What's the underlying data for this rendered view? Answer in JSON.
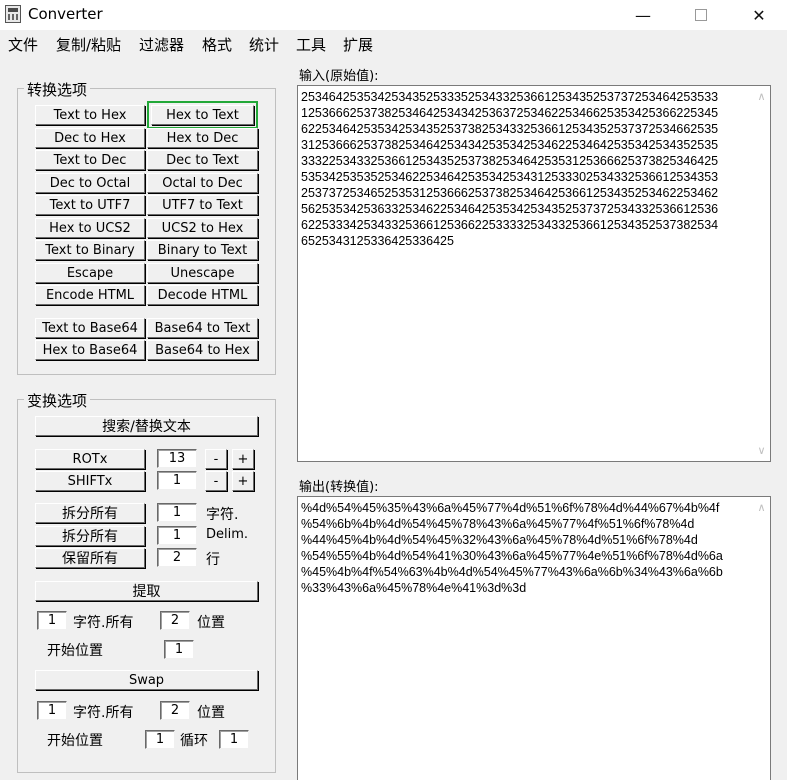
{
  "window": {
    "title": "Converter",
    "minimize": "—",
    "close": "✕"
  },
  "menu": [
    "文件",
    "复制/粘贴",
    "过滤器",
    "格式",
    "统计",
    "工具",
    "扩展"
  ],
  "convert_group": {
    "title": "转换选项",
    "buttons": [
      [
        "Text to Hex",
        "Hex to Text"
      ],
      [
        "Dec to Hex",
        "Hex to Dec"
      ],
      [
        "Text to Dec",
        "Dec to Text"
      ],
      [
        "Dec to Octal",
        "Octal to Dec"
      ],
      [
        "Text to UTF7",
        "UTF7 to Text"
      ],
      [
        "Hex to UCS2",
        "UCS2 to Hex"
      ],
      [
        "Text to Binary",
        "Binary to Text"
      ],
      [
        "Escape",
        "Unescape"
      ],
      [
        "Encode HTML",
        "Decode HTML"
      ],
      [
        "Text to Base64",
        "Base64 to Text"
      ],
      [
        "Hex to Base64",
        "Base64 to Hex"
      ]
    ]
  },
  "transform_group": {
    "title": "变换选项",
    "search_replace": "搜索/替换文本",
    "rot_label": "ROTx",
    "rot_value": "13",
    "shift_label": "SHIFTx",
    "shift_value": "1",
    "minus": "-",
    "plus": "+",
    "split_all_1": "拆分所有",
    "split_all_1_value": "1",
    "split_all_1_unit": "字符.",
    "split_all_2": "拆分所有",
    "split_all_2_value": "1",
    "split_all_2_unit": "Delim.",
    "keep_all": "保留所有",
    "keep_all_value": "2",
    "keep_all_unit": "行",
    "extract": "提取",
    "ex_value1": "1",
    "ex_char_all": "字符.所有",
    "ex_value2": "2",
    "ex_pos": "位置",
    "ex_start_label": "开始位置",
    "ex_start_value": "1",
    "swap": "Swap",
    "sw_value1": "1",
    "sw_char_all": "字符.所有",
    "sw_value2": "2",
    "sw_pos": "位置",
    "sw_start_label": "开始位置",
    "sw_start_value": "1",
    "sw_loop_label": "循环",
    "sw_loop_value": "1"
  },
  "input": {
    "label": "输入(原始值):",
    "lines": [
      "253464253534253435253335253433253661253435253737253464253533",
      "125366625373825346425343425363725346225346625353425366225345",
      "622534642535342534352537382534332536612534352537372534662535",
      "312536662537382534642534342535342534622534642535342534352535",
      "333225343325366125343525373825346425353125366625373825346425",
      "535342535352534622534642535342534312533302534332536612534353",
      "253737253465253531253666253738253464253661253435253462253462",
      "562535342536332534622534642535342534352537372534332536612536",
      "622533342534332536612536622533332534332536612534352537382534",
      "6525343125336425336425"
    ]
  },
  "output": {
    "label": "输出(转换值):",
    "lines": [
      "%4d%54%45%35%43%6a%45%77%4d%51%6f%78%4d%44%67%4b%4f",
      "%54%6b%4b%4d%54%45%78%43%6a%45%77%4f%51%6f%78%4d",
      "%44%45%4b%4d%54%45%32%43%6a%45%78%4d%51%6f%78%4d",
      "%54%55%4b%4d%54%41%30%43%6a%45%77%4e%51%6f%78%4d%6a",
      "%45%4b%4f%54%63%4b%4d%54%45%77%43%6a%6b%34%43%6a%6b",
      "%33%43%6a%45%78%4e%41%3d%3d"
    ]
  },
  "colors": {
    "highlight": "#22a838",
    "background": "#f0f0f0"
  }
}
